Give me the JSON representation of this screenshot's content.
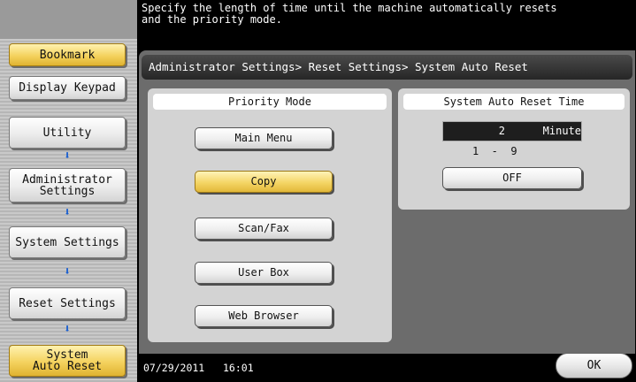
{
  "header": {
    "message": "Specify the length of time until the machine automatically resets\nand the priority mode."
  },
  "nav": {
    "bookmark": "Bookmark",
    "display_keypad": "Display Keypad",
    "utility": "Utility",
    "administrator_settings": "Administrator\nSettings",
    "system_settings": "System Settings",
    "reset_settings": "Reset Settings",
    "system_auto_reset": "System\nAuto Reset",
    "arrow_glyph": "⬇"
  },
  "breadcrumb": "Administrator Settings> Reset Settings> System Auto Reset",
  "priority_mode": {
    "heading": "Priority Mode",
    "options": [
      "Main Menu",
      "Copy",
      "Scan/Fax",
      "User Box",
      "Web Browser"
    ],
    "selected": "Copy"
  },
  "auto_reset_time": {
    "heading": "System Auto Reset Time",
    "value": "2",
    "unit": "Minute",
    "range": "1  -  9",
    "off_label": "OFF"
  },
  "footer": {
    "date": "07/29/2011",
    "time": "16:01",
    "ok_label": "OK"
  },
  "colors": {
    "selected_yellow": "#f4d25e",
    "arrow_blue": "#1a5fd0",
    "panel_grey": "#6c6c6c"
  }
}
